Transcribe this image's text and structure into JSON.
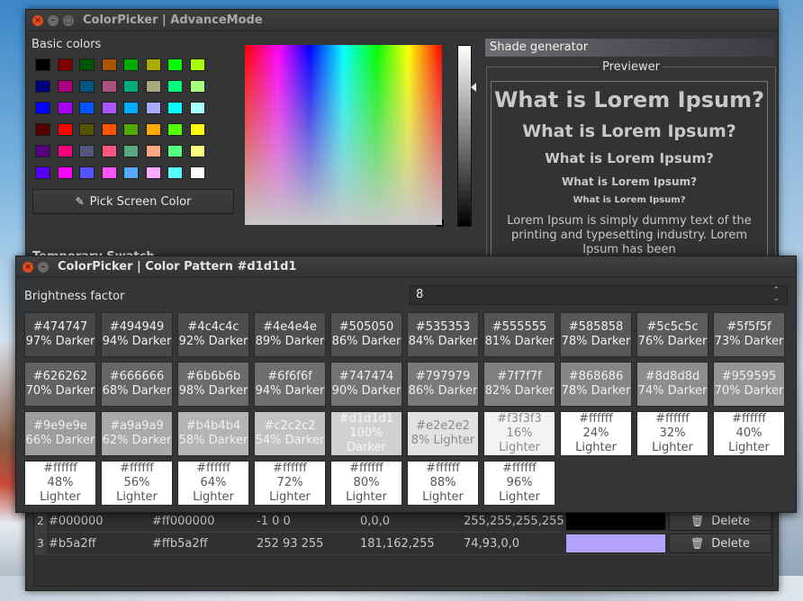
{
  "main_window": {
    "title": "ColorPicker | AdvanceMode",
    "basic_colors_label": "Basic colors",
    "basic_colors": [
      "#000000",
      "#800000",
      "#005500",
      "#aa5500",
      "#00aa00",
      "#aaaa00",
      "#00ff00",
      "#aaff00",
      "#00007f",
      "#aa007f",
      "#00557f",
      "#aa557f",
      "#00aa7f",
      "#aaaa7f",
      "#00ff7f",
      "#aaff7f",
      "#0000ff",
      "#aa00ff",
      "#0055ff",
      "#aa55ff",
      "#00aaff",
      "#aaaaff",
      "#00ffff",
      "#aaffff",
      "#550000",
      "#ff0000",
      "#555500",
      "#ff5500",
      "#55aa00",
      "#ffaa00",
      "#55ff00",
      "#ffff00",
      "#55007f",
      "#ff007f",
      "#55557f",
      "#ff557f",
      "#55aa7f",
      "#ffaa7f",
      "#55ff7f",
      "#ffff7f",
      "#5500ff",
      "#ff00ff",
      "#5555ff",
      "#ff55ff",
      "#55aaff",
      "#ffaaff",
      "#55ffff",
      "#ffffff"
    ],
    "pick_screen_color": "Pick Screen Color",
    "temporary_swatch_label": "Temporary Swatch",
    "shade_generator_label": "Shade generator",
    "previewer_label": "Previewer",
    "preview_headings": [
      "What is Lorem Ipsum?",
      "What is Lorem Ipsum?",
      "What is Lorem Ipsum?",
      "What is Lorem Ipsum?",
      "What is Lorem Ipsum?"
    ],
    "preview_body": "Lorem Ipsum is simply dummy text of the printing and typesetting industry. Lorem Ipsum has been"
  },
  "table": {
    "rows": [
      {
        "index": "2",
        "hex": "#000000",
        "argb": "#ff000000",
        "hsv": "-1 0 0",
        "rgb": "0,0,0",
        "rgba": "255,255,255,255",
        "color": "#000000",
        "delete_label": "Delete"
      },
      {
        "index": "3",
        "hex": "#b5a2ff",
        "argb": "#ffb5a2ff",
        "hsv": "252 93 255",
        "rgb": "181,162,255",
        "rgba": "74,93,0,0",
        "color": "#b5a2ff",
        "delete_label": "Delete"
      }
    ]
  },
  "pattern_window": {
    "title": "ColorPicker | Color Pattern #d1d1d1",
    "brightness_label": "Brightness factor",
    "brightness_value": "8",
    "tiles": [
      {
        "hex": "#474747",
        "label": "97% Darker"
      },
      {
        "hex": "#494949",
        "label": "94% Darker"
      },
      {
        "hex": "#4c4c4c",
        "label": "92% Darker"
      },
      {
        "hex": "#4e4e4e",
        "label": "89% Darker"
      },
      {
        "hex": "#505050",
        "label": "86% Darker"
      },
      {
        "hex": "#535353",
        "label": "84% Darker"
      },
      {
        "hex": "#555555",
        "label": "81% Darker"
      },
      {
        "hex": "#585858",
        "label": "78% Darker"
      },
      {
        "hex": "#5c5c5c",
        "label": "76% Darker"
      },
      {
        "hex": "#5f5f5f",
        "label": "73% Darker"
      },
      {
        "hex": "#626262",
        "label": "70% Darker"
      },
      {
        "hex": "#666666",
        "label": "68% Darker"
      },
      {
        "hex": "#6b6b6b",
        "label": "98% Darker"
      },
      {
        "hex": "#6f6f6f",
        "label": "94% Darker"
      },
      {
        "hex": "#747474",
        "label": "90% Darker"
      },
      {
        "hex": "#797979",
        "label": "86% Darker"
      },
      {
        "hex": "#7f7f7f",
        "label": "82% Darker"
      },
      {
        "hex": "#868686",
        "label": "78% Darker"
      },
      {
        "hex": "#8d8d8d",
        "label": "74% Darker"
      },
      {
        "hex": "#959595",
        "label": "70% Darker"
      },
      {
        "hex": "#9e9e9e",
        "label": "66% Darker"
      },
      {
        "hex": "#a9a9a9",
        "label": "62% Darker"
      },
      {
        "hex": "#b4b4b4",
        "label": "58% Darker"
      },
      {
        "hex": "#c2c2c2",
        "label": "54% Darker"
      },
      {
        "hex": "#d1d1d1",
        "label": "100% Darker"
      },
      {
        "hex": "#e2e2e2",
        "label": "8% Lighter"
      },
      {
        "hex": "#f3f3f3",
        "label": "16% Lighter"
      },
      {
        "hex": "#ffffff",
        "label": "24% Lighter"
      },
      {
        "hex": "#ffffff",
        "label": "32% Lighter"
      },
      {
        "hex": "#ffffff",
        "label": "40% Lighter"
      },
      {
        "hex": "#ffffff",
        "label": "48% Lighter"
      },
      {
        "hex": "#ffffff",
        "label": "56% Lighter"
      },
      {
        "hex": "#ffffff",
        "label": "64% Lighter"
      },
      {
        "hex": "#ffffff",
        "label": "72% Lighter"
      },
      {
        "hex": "#ffffff",
        "label": "80% Lighter"
      },
      {
        "hex": "#ffffff",
        "label": "88% Lighter"
      },
      {
        "hex": "#ffffff",
        "label": "96% Lighter"
      }
    ]
  }
}
